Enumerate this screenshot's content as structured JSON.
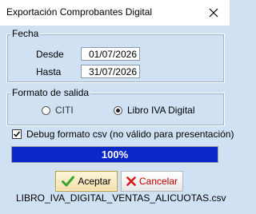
{
  "window": {
    "title": "Exportación Comprobantes Digital"
  },
  "fecha_group": {
    "legend": "Fecha",
    "desde_label": "Desde",
    "desde_value": "01/07/2026",
    "hasta_label": "Hasta",
    "hasta_value": "31/07/2026"
  },
  "formato_group": {
    "legend": "Formato de salida",
    "options": [
      {
        "label": "CITI",
        "selected": false
      },
      {
        "label": "Libro IVA Digital",
        "selected": true
      }
    ]
  },
  "debug": {
    "label": "Debug formato csv (no válido para presentación)",
    "checked": true
  },
  "progress": {
    "value": 100,
    "text": "100%",
    "color": "#0a27c8"
  },
  "buttons": {
    "accept_label": "Aceptar",
    "accept_icon": "checkmark-icon",
    "cancel_label": "Cancelar",
    "cancel_icon": "cross-icon"
  },
  "output_filename": "LIBRO_IVA_DIGITAL_VENTAS_ALICUOTAS.csv",
  "colors": {
    "background": "#cfe1f3",
    "accent_progress": "#0a27c8",
    "cancel_text": "#c00000"
  }
}
